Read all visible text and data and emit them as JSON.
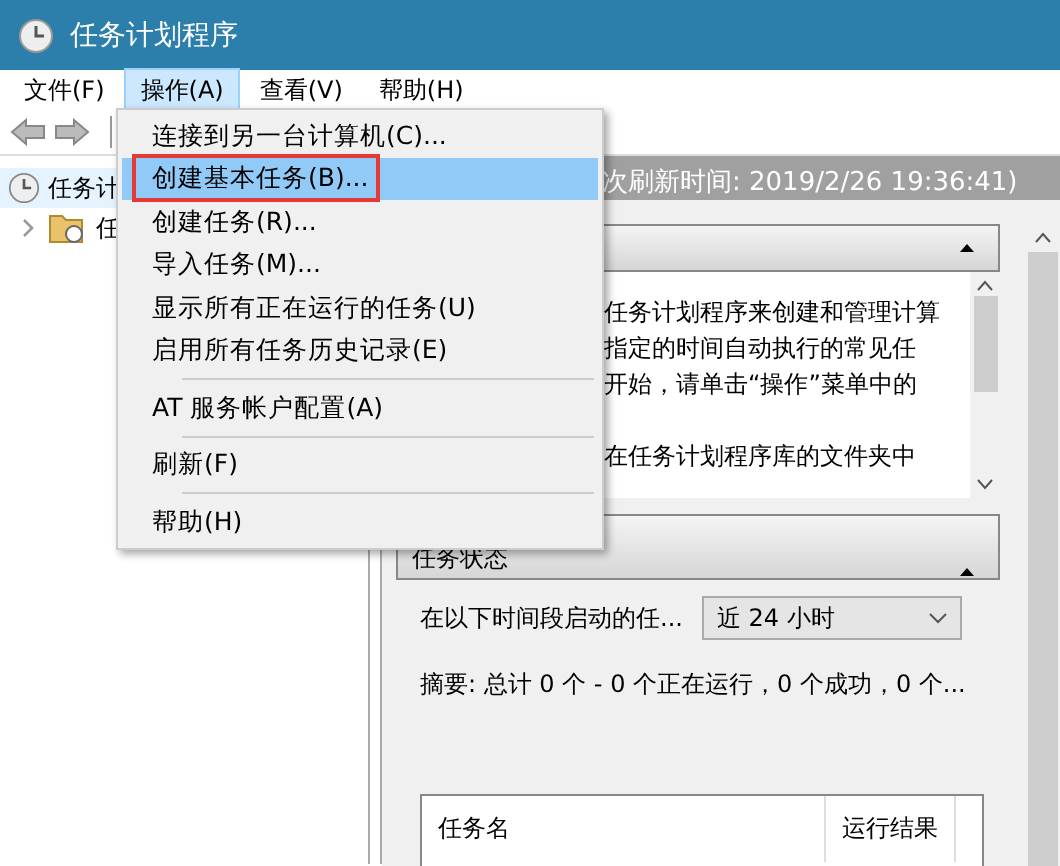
{
  "window": {
    "title": "任务计划程序"
  },
  "menubar": [
    {
      "label": "文件(F)",
      "selected": false
    },
    {
      "label": "操作(A)",
      "selected": true
    },
    {
      "label": "查看(V)",
      "selected": false
    },
    {
      "label": "帮助(H)",
      "selected": false
    }
  ],
  "menu": [
    {
      "kind": "item",
      "label": "连接到另一台计算机(C)...",
      "selected": false,
      "annotated": false
    },
    {
      "kind": "item",
      "label": "创建基本任务(B)...",
      "selected": true,
      "annotated": true
    },
    {
      "kind": "item",
      "label": "创建任务(R)...",
      "selected": false,
      "annotated": false
    },
    {
      "kind": "item",
      "label": "导入任务(M)...",
      "selected": false,
      "annotated": false
    },
    {
      "kind": "item",
      "label": "显示所有正在运行的任务(U)",
      "selected": false,
      "annotated": false
    },
    {
      "kind": "item",
      "label": "启用所有任务历史记录(E)",
      "selected": false,
      "annotated": false
    },
    {
      "kind": "separator"
    },
    {
      "kind": "item",
      "label": "AT 服务帐户配置(A)",
      "selected": false,
      "annotated": false
    },
    {
      "kind": "separator"
    },
    {
      "kind": "item",
      "label": "刷新(F)",
      "selected": false,
      "annotated": false
    },
    {
      "kind": "separator"
    },
    {
      "kind": "item",
      "label": "帮助(H)",
      "selected": false,
      "annotated": false
    }
  ],
  "tree": [
    {
      "label": "任务计",
      "selected": true,
      "children": [
        {
          "label": "任",
          "expanded": false,
          "selected": false
        }
      ]
    }
  ],
  "header": {
    "refresh_time": "次刷新时间: 2019/2/26 19:36:41)"
  },
  "overview": {
    "lines": [
      "任务计划程序来创建和管理计算",
      "指定的时间自动执行的常见任",
      "开始，请单击“操作”菜单中的",
      "在任务计划程序库的文件夹中"
    ]
  },
  "status": {
    "title": "任务状态",
    "period_label": "在以下时间段启动的任...",
    "period": "近 24 小时",
    "summary": "摘要: 总计 0 个 - 0 个正在运行，0 个成功，0 个...",
    "columns": [
      "任务名",
      "运行结果"
    ]
  }
}
